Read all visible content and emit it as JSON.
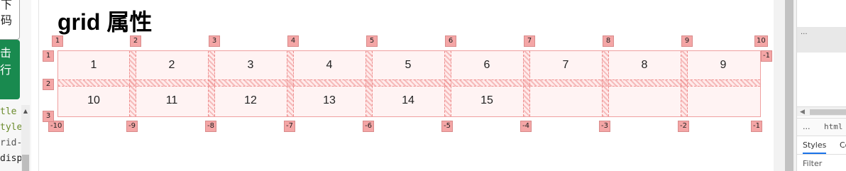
{
  "editor": {
    "top_button": [
      "下",
      "码"
    ],
    "run_button": [
      "击",
      "行"
    ],
    "code_lines": [
      {
        "text": "tle",
        "color": "#6c8c2e"
      },
      {
        "text": "tyle",
        "color": "#6c8c2e"
      },
      {
        "text": "rid-",
        "color": "#555555"
      },
      {
        "text": "disp",
        "color": "#222222"
      }
    ],
    "scroll_up_glyph": "▲"
  },
  "preview": {
    "title": "grid 属性",
    "cells": [
      "1",
      "2",
      "3",
      "4",
      "5",
      "6",
      "7",
      "8",
      "9",
      "10",
      "11",
      "12",
      "13",
      "14",
      "15"
    ],
    "column_count": 9,
    "row_count": 2,
    "top_column_badges": [
      "1",
      "2",
      "3",
      "4",
      "5",
      "6",
      "7",
      "8",
      "9",
      "10"
    ],
    "bottom_column_badges": [
      "-10",
      "-9",
      "-8",
      "-7",
      "-6",
      "-5",
      "-4",
      "-3",
      "-2",
      "-1"
    ],
    "left_row_badges": [
      "1",
      "2",
      "3"
    ],
    "right_row_badges": [
      "-1"
    ],
    "colors": {
      "grid_border": "#ef9f9f",
      "grid_fill": "#fff3f3",
      "badge_fill": "#f4a6a6"
    }
  },
  "devtools": {
    "top_dots": "...",
    "breadcrumb_dots": "...",
    "breadcrumb_html": "html",
    "tabs": [
      "Styles",
      "Co"
    ],
    "filter_placeholder": "Filter",
    "hscroll_arrow": "◀"
  }
}
